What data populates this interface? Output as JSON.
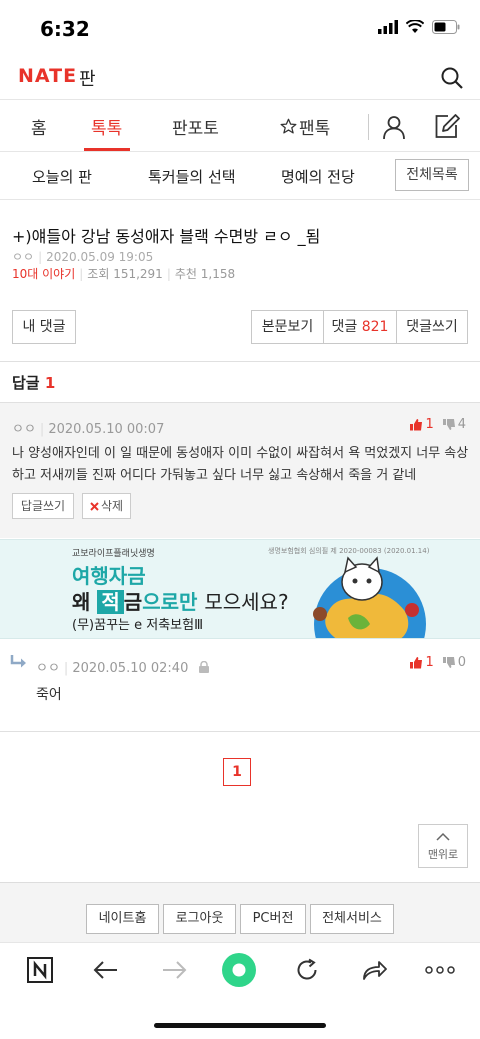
{
  "status": {
    "time": "6:32"
  },
  "header": {
    "logo": "NATE",
    "logo_sub": "판"
  },
  "tabs": [
    {
      "label": "홈"
    },
    {
      "label": "톡톡"
    },
    {
      "label": "판포토"
    },
    {
      "label": "팬톡"
    }
  ],
  "subnav": {
    "items": [
      "오늘의 판",
      "톡커들의 선택",
      "명예의 전당"
    ],
    "all_label": "전체목록"
  },
  "post": {
    "title": "+)얘들아 강남 동성애자 블랙 수면방 ㄹㅇ _됨",
    "author": "ㅇㅇ",
    "date": "2020.05.09 19:05",
    "category": "10대 이야기",
    "views": "조회 151,291",
    "recommends": "추천 1,158"
  },
  "actions": {
    "my_comments": "내 댓글",
    "view_body": "본문보기",
    "comments_label": "댓글",
    "comments_count": "821",
    "write_comment": "댓글쓰기"
  },
  "replies_header": {
    "label": "답글",
    "count": "1"
  },
  "comment": {
    "author": "ㅇㅇ",
    "date": "2020.05.10 00:07",
    "up": "1",
    "down": "4",
    "text": "나 양성애자인데 이 일 때문에 동성애자 이미 수없이 싸잡혀서 욕 먹었겠지 너무 속상하고 저새끼들 진짜 어디다 가둬놓고 싶다 너무 싫고 속상해서 죽을 거 같네",
    "reply_btn": "답글쓰기",
    "delete_btn": "삭제"
  },
  "ad": {
    "company": "교보라이프플래닛생명",
    "notice": "생명보험협회 심의필 제 2020-00083 (2020.01.14)",
    "line1": "여행자금",
    "line2_a": "왜",
    "line2_b": "적",
    "line2_c": "금",
    "line2_d": "으로만",
    "line2_e": "모으세요?",
    "line3": "(무)꿈꾸는 e 저축보험Ⅲ"
  },
  "reply": {
    "author": "ㅇㅇ",
    "date": "2020.05.10 02:40",
    "up": "1",
    "down": "0",
    "text": "죽어"
  },
  "pagination": {
    "current": "1"
  },
  "top_btn": "맨위로",
  "footer": [
    "네이트홈",
    "로그아웃",
    "PC버전",
    "전체서비스"
  ],
  "colors": {
    "accent": "#e8332a",
    "ad_teal": "#1ea7a7"
  }
}
